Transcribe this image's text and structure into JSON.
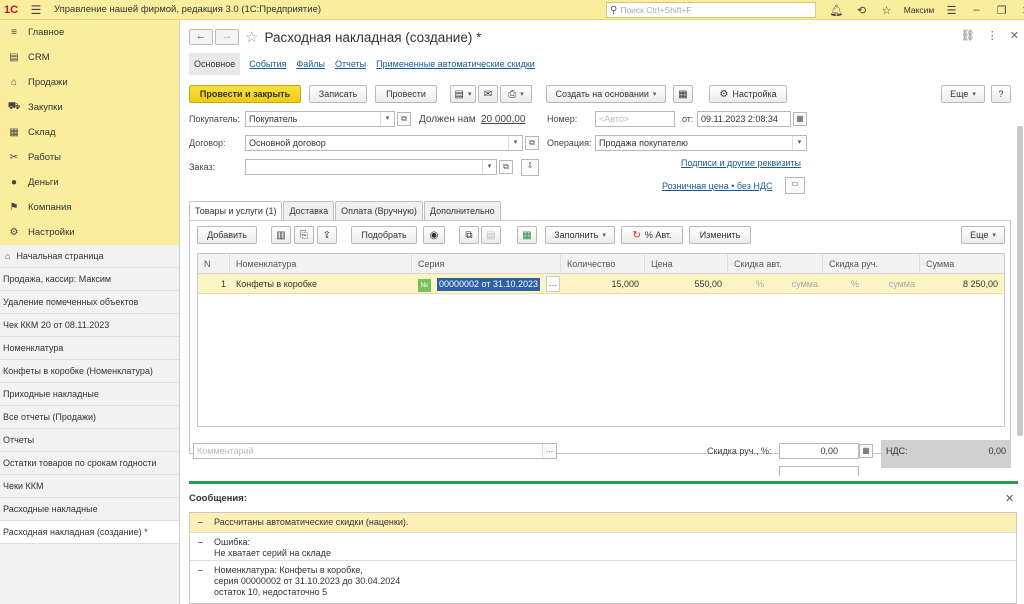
{
  "app": {
    "logo": "1С",
    "title": "Управление нашей фирмой, редакция 3.0  (1С:Предприятие)",
    "search_placeholder": "Поиск Ctrl+Shift+F",
    "user": "Максим"
  },
  "nav": [
    {
      "label": "Главное",
      "icon": "menu-icon"
    },
    {
      "label": "CRM",
      "icon": "crm-icon"
    },
    {
      "label": "Продажи",
      "icon": "cart-icon"
    },
    {
      "label": "Закупки",
      "icon": "purchase-icon"
    },
    {
      "label": "Склад",
      "icon": "warehouse-icon"
    },
    {
      "label": "Работы",
      "icon": "tools-icon"
    },
    {
      "label": "Деньги",
      "icon": "money-icon"
    },
    {
      "label": "Компания",
      "icon": "flag-icon"
    },
    {
      "label": "Настройки",
      "icon": "gear-icon"
    }
  ],
  "open_windows": [
    "Начальная страница",
    "Продажа, кассир: Максим",
    "Удаление помеченных объектов",
    "Чек ККМ 20 от 08.11.2023",
    "Номенклатура",
    "Конфеты в коробке (Номенклатура)",
    "Приходные накладные",
    "Все отчеты (Продажи)",
    "Отчеты",
    "Остатки товаров по срокам годности",
    "Чеки ККМ",
    "Расходные накладные",
    "Расходная накладная (создание) *"
  ],
  "doc": {
    "title": "Расходная накладная (создание) *",
    "subtabs": [
      "Основное",
      "События",
      "Файлы",
      "Отчеты",
      "Примененные автоматические скидки"
    ],
    "toolbar": {
      "post_close": "Провести и закрыть",
      "save": "Записать",
      "post": "Провести",
      "create_based": "Создать на основании",
      "settings": "Настройка",
      "more": "Еще",
      "help": "?"
    },
    "fields": {
      "buyer_label": "Покупатель:",
      "buyer_value": "Покупатель",
      "owes_label": "Должен нам",
      "owes_value": "20 000,00",
      "number_label": "Номер:",
      "number_placeholder": "<Авто>",
      "date_label": "от:",
      "date_value": "09.11.2023  2:08:34",
      "contract_label": "Договор:",
      "contract_value": "Основной договор",
      "operation_label": "Операция:",
      "operation_value": "Продажа покупателю",
      "order_label": "Заказ:",
      "order_value": "",
      "signatures_link": "Подписи и другие реквизиты",
      "price_link": "Розничная цена • без НДС"
    },
    "tabs": [
      "Товары и услуги (1)",
      "Доставка",
      "Оплата (Вручную)",
      "Дополнительно"
    ],
    "table_toolbar": {
      "add": "Добавить",
      "pick": "Подобрать",
      "fill": "Заполнить",
      "auto_pct": "% Авт.",
      "change": "Изменить",
      "more": "Еще"
    },
    "columns": [
      "N",
      "Номенклатура",
      "Серия",
      "Количество",
      "Цена",
      "Скидка авт.",
      "Скидка руч.",
      "Сумма"
    ],
    "rows": [
      {
        "n": "1",
        "item": "Конфеты в коробке",
        "series": "00000002 от 31.10.2023",
        "qty": "15,000",
        "price": "550,00",
        "disc_auto_pct": "%",
        "disc_auto_sum": "сумма",
        "disc_man_pct": "%",
        "disc_man_sum": "сумма",
        "sum": "8 250,00"
      }
    ],
    "comment_placeholder": "Комментарий",
    "manual_discount_label": "Скидка руч., %:",
    "manual_discount_value": "0,00",
    "vat_label": "НДС:",
    "vat_value": "0,00"
  },
  "messages": {
    "title": "Сообщения:",
    "items": [
      {
        "text": "Рассчитаны автоматические скидки (наценки)."
      },
      {
        "text": "Ошибка:",
        "text2": "Не хватает серий на складе"
      },
      {
        "text": "Номенклатура: Конфеты в коробке,",
        "text2": "серия 00000002 от 31.10.2023 до 30.04.2024",
        "text3": "остаток 10, недостаточно 5"
      }
    ]
  }
}
